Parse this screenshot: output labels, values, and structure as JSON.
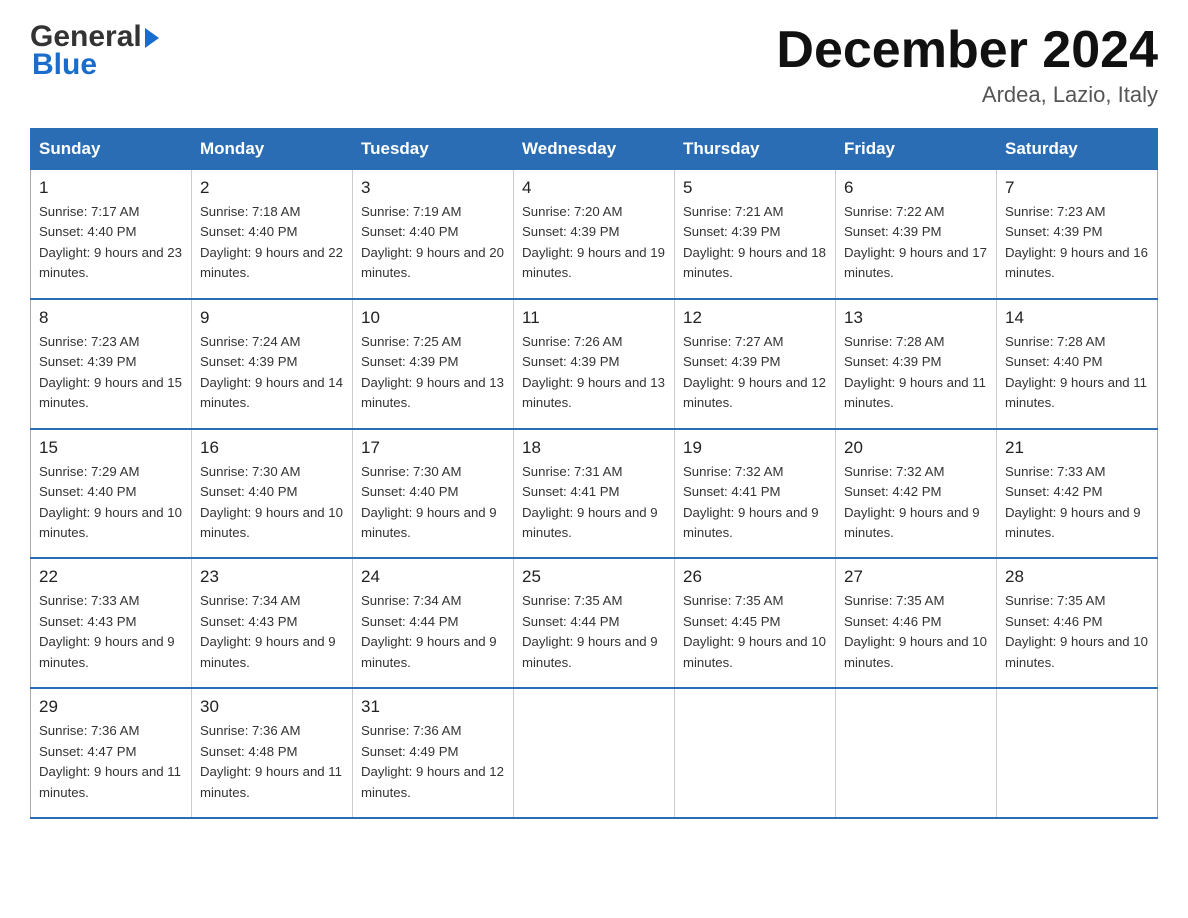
{
  "header": {
    "logo_general": "General",
    "logo_blue": "Blue",
    "month_title": "December 2024",
    "location": "Ardea, Lazio, Italy"
  },
  "days_of_week": [
    "Sunday",
    "Monday",
    "Tuesday",
    "Wednesday",
    "Thursday",
    "Friday",
    "Saturday"
  ],
  "weeks": [
    [
      {
        "day": "1",
        "sunrise": "7:17 AM",
        "sunset": "4:40 PM",
        "daylight": "9 hours and 23 minutes."
      },
      {
        "day": "2",
        "sunrise": "7:18 AM",
        "sunset": "4:40 PM",
        "daylight": "9 hours and 22 minutes."
      },
      {
        "day": "3",
        "sunrise": "7:19 AM",
        "sunset": "4:40 PM",
        "daylight": "9 hours and 20 minutes."
      },
      {
        "day": "4",
        "sunrise": "7:20 AM",
        "sunset": "4:39 PM",
        "daylight": "9 hours and 19 minutes."
      },
      {
        "day": "5",
        "sunrise": "7:21 AM",
        "sunset": "4:39 PM",
        "daylight": "9 hours and 18 minutes."
      },
      {
        "day": "6",
        "sunrise": "7:22 AM",
        "sunset": "4:39 PM",
        "daylight": "9 hours and 17 minutes."
      },
      {
        "day": "7",
        "sunrise": "7:23 AM",
        "sunset": "4:39 PM",
        "daylight": "9 hours and 16 minutes."
      }
    ],
    [
      {
        "day": "8",
        "sunrise": "7:23 AM",
        "sunset": "4:39 PM",
        "daylight": "9 hours and 15 minutes."
      },
      {
        "day": "9",
        "sunrise": "7:24 AM",
        "sunset": "4:39 PM",
        "daylight": "9 hours and 14 minutes."
      },
      {
        "day": "10",
        "sunrise": "7:25 AM",
        "sunset": "4:39 PM",
        "daylight": "9 hours and 13 minutes."
      },
      {
        "day": "11",
        "sunrise": "7:26 AM",
        "sunset": "4:39 PM",
        "daylight": "9 hours and 13 minutes."
      },
      {
        "day": "12",
        "sunrise": "7:27 AM",
        "sunset": "4:39 PM",
        "daylight": "9 hours and 12 minutes."
      },
      {
        "day": "13",
        "sunrise": "7:28 AM",
        "sunset": "4:39 PM",
        "daylight": "9 hours and 11 minutes."
      },
      {
        "day": "14",
        "sunrise": "7:28 AM",
        "sunset": "4:40 PM",
        "daylight": "9 hours and 11 minutes."
      }
    ],
    [
      {
        "day": "15",
        "sunrise": "7:29 AM",
        "sunset": "4:40 PM",
        "daylight": "9 hours and 10 minutes."
      },
      {
        "day": "16",
        "sunrise": "7:30 AM",
        "sunset": "4:40 PM",
        "daylight": "9 hours and 10 minutes."
      },
      {
        "day": "17",
        "sunrise": "7:30 AM",
        "sunset": "4:40 PM",
        "daylight": "9 hours and 9 minutes."
      },
      {
        "day": "18",
        "sunrise": "7:31 AM",
        "sunset": "4:41 PM",
        "daylight": "9 hours and 9 minutes."
      },
      {
        "day": "19",
        "sunrise": "7:32 AM",
        "sunset": "4:41 PM",
        "daylight": "9 hours and 9 minutes."
      },
      {
        "day": "20",
        "sunrise": "7:32 AM",
        "sunset": "4:42 PM",
        "daylight": "9 hours and 9 minutes."
      },
      {
        "day": "21",
        "sunrise": "7:33 AM",
        "sunset": "4:42 PM",
        "daylight": "9 hours and 9 minutes."
      }
    ],
    [
      {
        "day": "22",
        "sunrise": "7:33 AM",
        "sunset": "4:43 PM",
        "daylight": "9 hours and 9 minutes."
      },
      {
        "day": "23",
        "sunrise": "7:34 AM",
        "sunset": "4:43 PM",
        "daylight": "9 hours and 9 minutes."
      },
      {
        "day": "24",
        "sunrise": "7:34 AM",
        "sunset": "4:44 PM",
        "daylight": "9 hours and 9 minutes."
      },
      {
        "day": "25",
        "sunrise": "7:35 AM",
        "sunset": "4:44 PM",
        "daylight": "9 hours and 9 minutes."
      },
      {
        "day": "26",
        "sunrise": "7:35 AM",
        "sunset": "4:45 PM",
        "daylight": "9 hours and 10 minutes."
      },
      {
        "day": "27",
        "sunrise": "7:35 AM",
        "sunset": "4:46 PM",
        "daylight": "9 hours and 10 minutes."
      },
      {
        "day": "28",
        "sunrise": "7:35 AM",
        "sunset": "4:46 PM",
        "daylight": "9 hours and 10 minutes."
      }
    ],
    [
      {
        "day": "29",
        "sunrise": "7:36 AM",
        "sunset": "4:47 PM",
        "daylight": "9 hours and 11 minutes."
      },
      {
        "day": "30",
        "sunrise": "7:36 AM",
        "sunset": "4:48 PM",
        "daylight": "9 hours and 11 minutes."
      },
      {
        "day": "31",
        "sunrise": "7:36 AM",
        "sunset": "4:49 PM",
        "daylight": "9 hours and 12 minutes."
      },
      null,
      null,
      null,
      null
    ]
  ]
}
